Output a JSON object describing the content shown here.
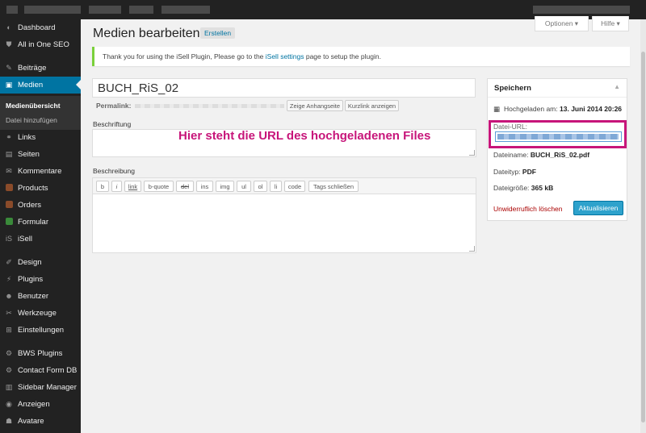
{
  "sidebar": {
    "items": [
      {
        "label": "Dashboard",
        "icon": "dashboard-icon",
        "glyph": "◐"
      },
      {
        "label": "All in One SEO",
        "icon": "shield-icon",
        "glyph": "⛊"
      },
      {
        "label": "Beiträge",
        "icon": "pin-icon",
        "glyph": "✎"
      },
      {
        "label": "Medien",
        "icon": "media-icon",
        "glyph": "▣"
      },
      {
        "label": "Links",
        "icon": "link-icon",
        "glyph": "⚭"
      },
      {
        "label": "Seiten",
        "icon": "pages-icon",
        "glyph": "▤"
      },
      {
        "label": "Kommentare",
        "icon": "comment-icon",
        "glyph": "✉"
      },
      {
        "label": "Products",
        "icon": "products-icon",
        "glyph": "■",
        "color": "#8a4b2a"
      },
      {
        "label": "Orders",
        "icon": "orders-icon",
        "glyph": "■",
        "color": "#8a4b2a"
      },
      {
        "label": "Formular",
        "icon": "form-icon",
        "glyph": "■",
        "color": "#3a8a3a"
      },
      {
        "label": "iSell",
        "icon": "isell-icon",
        "glyph": "iS"
      },
      {
        "label": "Design",
        "icon": "brush-icon",
        "glyph": "✐"
      },
      {
        "label": "Plugins",
        "icon": "plug-icon",
        "glyph": "⚡"
      },
      {
        "label": "Benutzer",
        "icon": "user-icon",
        "glyph": "☻"
      },
      {
        "label": "Werkzeuge",
        "icon": "wrench-icon",
        "glyph": "✂"
      },
      {
        "label": "Einstellungen",
        "icon": "settings-icon",
        "glyph": "⊞"
      },
      {
        "label": "BWS Plugins",
        "icon": "gear-icon",
        "glyph": "⚙"
      },
      {
        "label": "Contact Form DB",
        "icon": "gear-icon",
        "glyph": "⚙"
      },
      {
        "label": "Sidebar Manager",
        "icon": "sidebar-icon",
        "glyph": "▥"
      },
      {
        "label": "Anzeigen",
        "icon": "ads-icon",
        "glyph": "◉"
      },
      {
        "label": "Avatare",
        "icon": "avatar-icon",
        "glyph": "☗"
      }
    ],
    "submenu": {
      "overview": "Medienübersicht",
      "add": "Datei hinzufügen"
    }
  },
  "header": {
    "title": "Medien bearbeiten",
    "create_label": "Erstellen",
    "options_tab": "Optionen ▾",
    "help_tab": "Hilfe ▾"
  },
  "notice": {
    "before": "Thank you for using the iSell Plugin, Please go to the ",
    "link": "iSell settings",
    "after": " page to setup the plugin."
  },
  "editor": {
    "title_value": "BUCH_RiS_02",
    "permalink_label": "Permalink:",
    "show_page_btn": "Zeige Anhangseite",
    "shortlink_btn": "Kurzlink anzeigen",
    "caption_label": "Beschriftung",
    "caption_value": "",
    "annotation": "Hier steht die URL des hochgeladenen Files",
    "description_label": "Beschreibung",
    "quicktags": [
      "b",
      "i",
      "link",
      "b-quote",
      "del",
      "ins",
      "img",
      "ul",
      "ol",
      "li",
      "code",
      "Tags schließen"
    ]
  },
  "savebox": {
    "title": "Speichern",
    "uploaded_label": "Hochgeladen am:",
    "uploaded_value": "13. Juni 2014 20:26",
    "url_label": "Datei-URL:",
    "filename_label": "Dateiname:",
    "filename_value": "BUCH_RiS_02.pdf",
    "filetype_label": "Dateityp:",
    "filetype_value": "PDF",
    "filesize_label": "Dateigröße:",
    "filesize_value": "365 kB",
    "delete_label": "Unwiderruflich löschen",
    "update_label": "Aktualisieren"
  },
  "colors": {
    "accent": "#0074a2",
    "annotation": "#c7157a",
    "notice_border": "#7ad03a"
  }
}
